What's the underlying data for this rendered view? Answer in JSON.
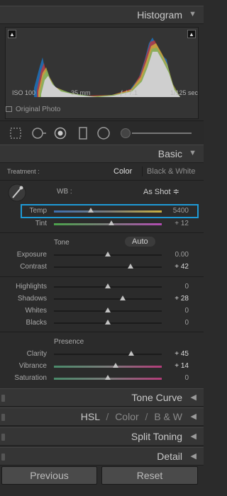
{
  "histogram": {
    "title": "Histogram",
    "iso": "ISO 100",
    "focal": "35 mm",
    "aperture": "ƒ / 7.1",
    "shutter": "1/125 sec",
    "original_photo": "Original Photo"
  },
  "tools": [
    "crop-icon",
    "spot-removal-icon",
    "red-eye-icon",
    "graduated-filter-icon",
    "radial-filter-icon",
    "adjustment-brush-icon"
  ],
  "basic": {
    "title": "Basic",
    "treatment_label": "Treatment :",
    "treatment_color": "Color",
    "treatment_bw": "Black & White",
    "wb_label": "WB :",
    "wb_value": "As Shot ≑",
    "temp": {
      "label": "Temp",
      "value": "5400",
      "pos": 0.3
    },
    "tint": {
      "label": "Tint",
      "value": "+ 12",
      "pos": 0.52
    },
    "tone_label": "Tone",
    "auto_label": "Auto",
    "tone": [
      {
        "label": "Exposure",
        "value": "0.00",
        "pos": 0.5,
        "bright": false
      },
      {
        "label": "Contrast",
        "value": "+ 42",
        "pos": 0.71,
        "bright": true
      }
    ],
    "tone2": [
      {
        "label": "Highlights",
        "value": "0",
        "pos": 0.5,
        "bright": false
      },
      {
        "label": "Shadows",
        "value": "+ 28",
        "pos": 0.64,
        "bright": true
      },
      {
        "label": "Whites",
        "value": "0",
        "pos": 0.5,
        "bright": false
      },
      {
        "label": "Blacks",
        "value": "0",
        "pos": 0.5,
        "bright": false
      }
    ],
    "presence_label": "Presence",
    "presence": [
      {
        "label": "Clarity",
        "value": "+ 45",
        "pos": 0.72,
        "bright": true
      },
      {
        "label": "Vibrance",
        "value": "+ 14",
        "pos": 0.57,
        "bright": true
      },
      {
        "label": "Saturation",
        "value": "0",
        "pos": 0.5,
        "bright": false
      }
    ]
  },
  "panels": {
    "tone_curve": "Tone Curve",
    "hsl": "HSL",
    "sep": "/",
    "color": "Color",
    "bw": "B & W",
    "split_toning": "Split Toning",
    "detail": "Detail"
  },
  "buttons": {
    "previous": "Previous",
    "reset": "Reset"
  },
  "colors": {
    "highlight": "#1e9ad6"
  }
}
